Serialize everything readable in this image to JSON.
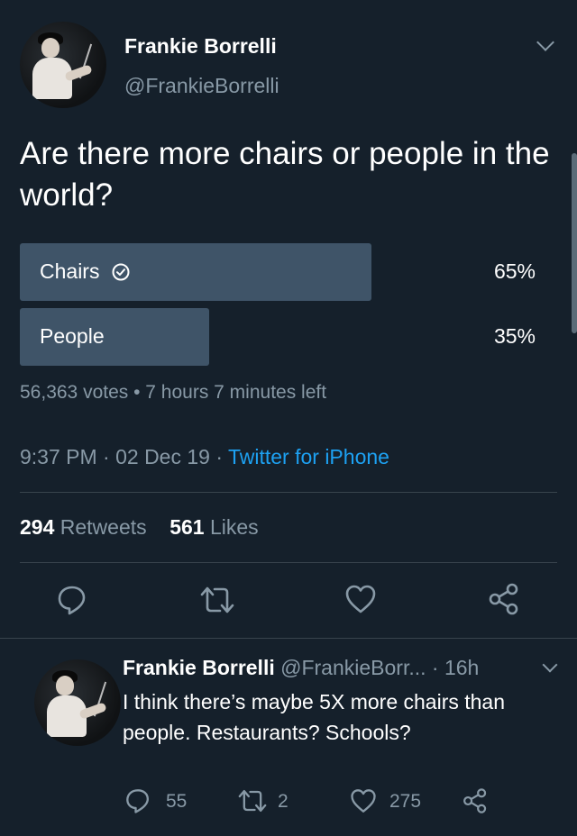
{
  "tweet": {
    "author_name": "Frankie Borrelli",
    "author_handle": "@FrankieBorrelli",
    "question": "Are there more chairs or people in the world?",
    "poll": {
      "options": [
        {
          "label": "Chairs",
          "percent_text": "65%",
          "fraction": 0.65,
          "winner": true
        },
        {
          "label": "People",
          "percent_text": "35%",
          "fraction": 0.35,
          "winner": false
        }
      ],
      "summary": "56,363 votes • 7 hours 7 minutes left"
    },
    "timestamp": "9:37 PM · 02 Dec 19 · ",
    "client": "Twitter for iPhone",
    "retweets_count": "294",
    "retweets_label": "Retweets",
    "likes_count": "561",
    "likes_label": "Likes"
  },
  "reply": {
    "author_name": "Frankie Borrelli",
    "author_handle": "@FrankieBorr...",
    "time": "· 16h",
    "text": "I think there’s maybe 5X more chairs than people. Restaurants? Schools?",
    "reply_count": "55",
    "retweet_count": "2",
    "like_count": "275"
  },
  "colors": {
    "background": "#15202b",
    "poll_bar": "#3f5468",
    "secondary_text": "#8899a6",
    "link": "#1da1f2",
    "divider": "#38444d"
  },
  "icons": [
    "chevron-down-icon",
    "check-circle-icon",
    "reply-icon",
    "retweet-icon",
    "heart-icon",
    "share-icon"
  ]
}
